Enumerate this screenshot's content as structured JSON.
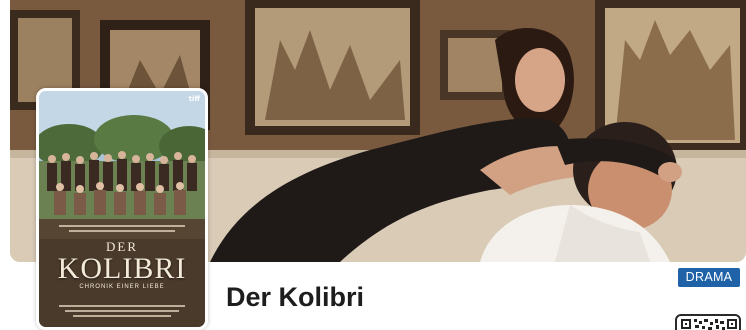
{
  "movie": {
    "title": "Der Kolibri",
    "genre": "DRAMA"
  },
  "poster": {
    "title_article": "DER",
    "title_main": "KOLIBRI",
    "tagline": "CHRONIK EINER LIEBE",
    "badge": "tiff"
  },
  "colors": {
    "genre_badge_bg": "#1f62a8",
    "title_text": "#1d1d1d"
  },
  "icons": {
    "qr": "qr-code-icon"
  }
}
